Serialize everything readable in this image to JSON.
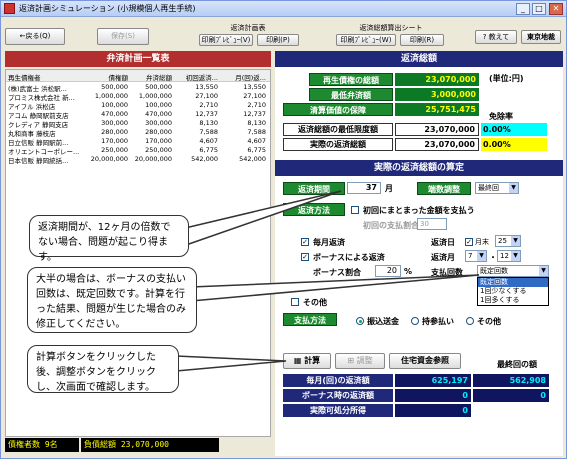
{
  "window": {
    "title": "返済計画シミュレーション (小規模個人再生手続)",
    "min": "_",
    "max": "□",
    "close": "✕"
  },
  "toolbar": {
    "back": "←戻る(Q)",
    "save": "保存(S)",
    "group1_title": "返済計画表",
    "preview1": "印刷ﾌﾟﾚﾋﾞｭｰ(V)",
    "print1": "印刷(P)",
    "group2_title": "返済総額算出シート",
    "preview2": "印刷ﾌﾟﾚﾋﾞｭｰ(W)",
    "print2": "印刷(R)",
    "help": "? 教えて",
    "location": "東京地裁"
  },
  "left": {
    "heading": "弁済計画一覧表",
    "columns": [
      "再生債権者",
      "債権額",
      "弁済総額",
      "初回返済...",
      "月(回)返..."
    ],
    "rows": [
      [
        "(株)武富士 浜松駅...",
        "500,000",
        "500,000",
        "13,550",
        "13,550"
      ],
      [
        "プロミス株式会社 新...",
        "1,000,000",
        "1,000,000",
        "27,100",
        "27,100"
      ],
      [
        "アイフル 浜松店",
        "100,000",
        "100,000",
        "2,710",
        "2,710"
      ],
      [
        "アコム 静岡駅前支店",
        "470,000",
        "470,000",
        "12,737",
        "12,737"
      ],
      [
        "クレディア 静岡支店",
        "300,000",
        "300,000",
        "8,130",
        "8,130"
      ],
      [
        "丸和商事 藤枝店",
        "280,000",
        "280,000",
        "7,588",
        "7,588"
      ],
      [
        "日立信販 静岡駅前...",
        "170,000",
        "170,000",
        "4,607",
        "4,607"
      ],
      [
        "オリエントコーポレー...",
        "250,000",
        "250,000",
        "6,775",
        "6,775"
      ],
      [
        "日本信販 静岡統括...",
        "20,000,000",
        "20,000,000",
        "542,000",
        "542,000"
      ]
    ],
    "status_count": "債権者数 9名",
    "status_total": "負債総額 23,070,000"
  },
  "summary": {
    "heading": "返済総額",
    "unit": "(単位:円)",
    "r1_label": "再生債権の総額",
    "r1_value": "23,070,000",
    "r2_label": "最低弁済額",
    "r2_value": "3,000,000",
    "r3_label": "清算価値の保障",
    "r3_value": "25,751,475",
    "waiver_label": "免除率",
    "r4_label": "返済総額の最低限度額",
    "r4_value": "23,070,000",
    "r4_rate": "0.00%",
    "r5_label": "実際の返済総額",
    "r5_value": "23,070,000",
    "r5_rate": "0.00%"
  },
  "calc": {
    "heading": "実際の返済総額の算定",
    "period_label": "返済期間",
    "period_value": "37",
    "period_unit": "月",
    "rounding_label": "端数調整",
    "rounding_value": "最終回",
    "method_label": "返済方法",
    "first_lump": "初回にまとまった金額を支払う",
    "first_ratio_label": "初回の支払割合",
    "first_ratio_value": "30",
    "monthly": "毎月返済",
    "bonus": "ボーナスによる返済",
    "bonus_ratio_label": "ボーナス割合",
    "bonus_ratio_value": "20",
    "pct": "%",
    "pay_day_label": "返済日",
    "pay_day_option": "月末",
    "pay_day_value": "25",
    "pay_month_label": "返済月",
    "pay_month_a": "7",
    "pay_month_b": "12",
    "count_label": "支払回数",
    "count_value": "既定回数",
    "count_options": [
      "既定回数",
      "1回少なくする",
      "1回多くする"
    ],
    "other": "その他",
    "pay_method_label": "支払方法",
    "pm1": "振込送金",
    "pm2": "持参払い",
    "pm3": "その他",
    "calc_btn": "計算",
    "adjust_btn": "調整",
    "housing_btn": "住宅資金参照",
    "last_label": "最終回の額",
    "monthly_amount_label": "毎月(回)の返済額",
    "monthly_amount": "625,197",
    "monthly_last": "562,908",
    "bonus_amount_label": "ボーナス時の返済額",
    "bonus_amount": "0",
    "bonus_last": "0",
    "disposable_label": "実際可処分所得",
    "disposable": "0"
  },
  "callouts": {
    "c1": "返済期間が、12ヶ月の倍数でない場合、問題が起こり得ます。",
    "c2": "大半の場合は、ボーナスの支払い回数は、既定回数です。計算を行った結果、問題が生じた場合のみ修正してください。",
    "c3": "計算ボタンをクリックした後、調整ボタンをクリックし、次画面で確認します。"
  }
}
